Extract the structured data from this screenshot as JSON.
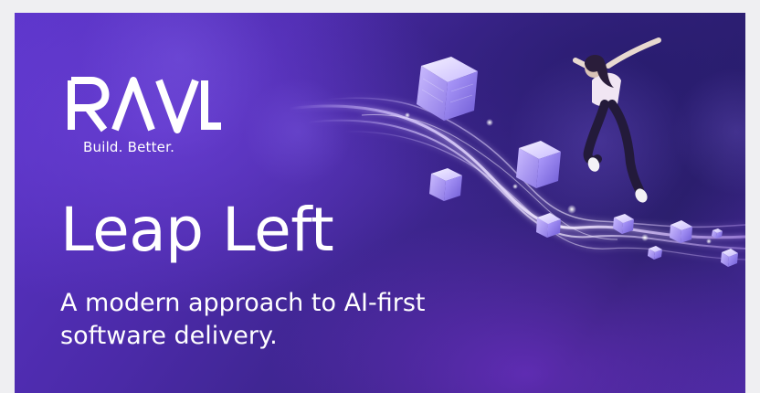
{
  "brand": {
    "name": "RAVL",
    "tagline": "Build. Better."
  },
  "hero": {
    "headline": "Leap Left",
    "subhead_line1": "A modern approach to AI-first",
    "subhead_line2": "software delivery."
  },
  "colors": {
    "background_primary": "#4b2aa8",
    "background_dark": "#2c1f6e",
    "text": "#ffffff",
    "glow": "#b89cff"
  }
}
